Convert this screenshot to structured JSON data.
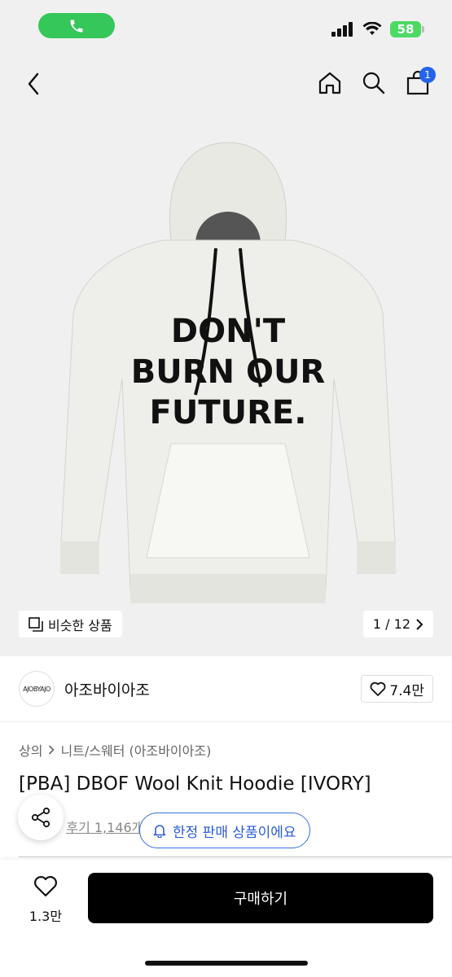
{
  "status": {
    "battery": "58"
  },
  "nav": {
    "cart_count": "1"
  },
  "hero": {
    "graphic_text_lines": [
      "DON'T",
      "BURN OUR",
      "FUTURE."
    ],
    "similar_label": "비슷한 상품",
    "pager": "1 / 12"
  },
  "brand": {
    "logo_text": "AJOBYAJO",
    "name": "아조바이아조",
    "likes": "7.4만"
  },
  "breadcrumb": {
    "level1": "상의",
    "level2": "니트/스웨터 (아조바이아조)"
  },
  "product": {
    "title": "[PBA] DBOF Wool Knit Hoodie [IVORY]"
  },
  "review": {
    "label": "후기 1,146개"
  },
  "limited": {
    "label": "한정 판매 상품이에요"
  },
  "bottom": {
    "wish_count": "1.3만",
    "buy_label": "구매하기"
  },
  "colors": {
    "accent_blue": "#2563eb",
    "call_green": "#35c759",
    "buy_black": "#000000"
  }
}
